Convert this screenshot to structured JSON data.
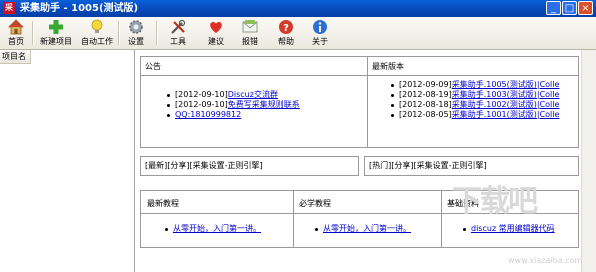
{
  "window": {
    "icon_char": "采",
    "title": "采集助手 - 1005(测试版)",
    "min": "_",
    "max": "□",
    "close": "×"
  },
  "toolbar": [
    {
      "key": "home",
      "label": "首页",
      "icon": "home-icon"
    },
    {
      "key": "new",
      "label": "新建项目",
      "icon": "plus-icon"
    },
    {
      "key": "auto",
      "label": "自动工作",
      "icon": "lightbulb-icon"
    },
    {
      "key": "settings",
      "label": "设置",
      "icon": "gear-icon"
    },
    {
      "key": "tools",
      "label": "工具",
      "icon": "tools-icon"
    },
    {
      "key": "suggest",
      "label": "建议",
      "icon": "heart-icon"
    },
    {
      "key": "bug",
      "label": "报错",
      "icon": "envelope-icon"
    },
    {
      "key": "help",
      "label": "帮助",
      "icon": "help-icon"
    },
    {
      "key": "about",
      "label": "关于",
      "icon": "info-icon"
    }
  ],
  "left_panel": {
    "header": "项目名"
  },
  "announcements": {
    "title": "公告",
    "items": [
      {
        "date": "[2012-09-10]",
        "text": "Discuz交流群"
      },
      {
        "date": "[2012-09-10]",
        "text": "免费写采集规则联系",
        "text2": "QQ:1810999812"
      }
    ]
  },
  "versions": {
    "title": "最新版本",
    "items": [
      {
        "date": "[2012-09-09]",
        "text": "采集助手.1005(测试版)|Colle"
      },
      {
        "date": "[2012-08-19]",
        "text": "采集助手.1003(测试版)|Colle"
      },
      {
        "date": "[2012-08-18]",
        "text": "采集助手.1002(测试版)|Colle"
      },
      {
        "date": "[2012-08-05]",
        "text": "采集助手.1001(测试版)|Colle"
      }
    ]
  },
  "tags_left": "[最新][分享][采集设置-正则引擎]",
  "tags_right": "[热门][分享][采集设置-正则引擎]",
  "tutorials": [
    {
      "title": "最新教程",
      "link": "从零开始，入门第一讲。"
    },
    {
      "title": "必学教程",
      "link": "从零开始，入门第一讲。"
    },
    {
      "title": "基础资料",
      "link": "discuz 常用编辑器代码"
    }
  ],
  "watermark": {
    "text": "下载吧",
    "sub": "www.xiazaiba.com"
  }
}
